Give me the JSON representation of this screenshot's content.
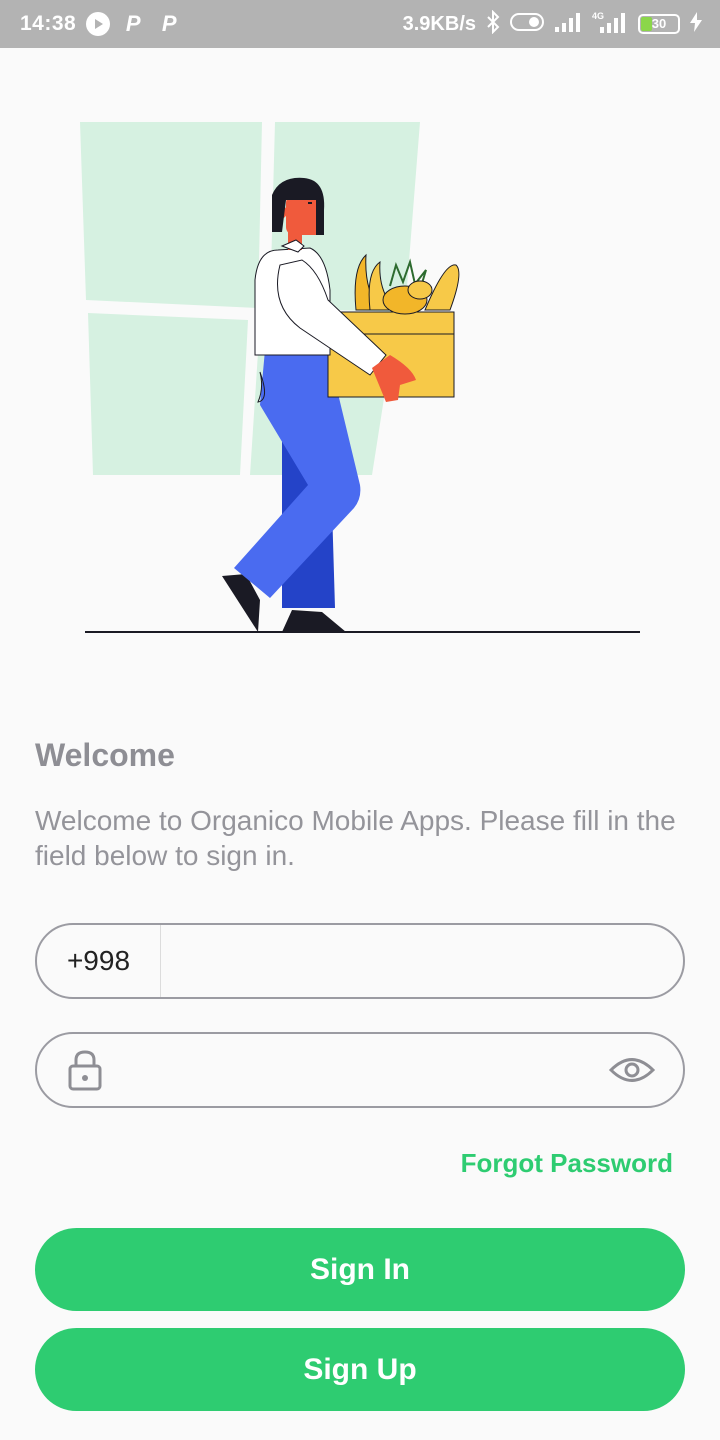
{
  "status_bar": {
    "time": "14:38",
    "app_icon_1": "P",
    "app_icon_2": "P",
    "speed": "3.9KB/s",
    "battery": "30",
    "icons": [
      "play-circle-icon",
      "bluetooth-icon",
      "toggle-icon",
      "signal-icon",
      "signal-4g-icon",
      "battery-icon",
      "charging-bolt-icon"
    ]
  },
  "illustration": {
    "name": "woman-carrying-groceries",
    "colors": {
      "window": "#d6f1e1",
      "pants": "#4a6bf0",
      "box": "#f7c948",
      "skin": "#f05a3c",
      "shirt": "#ffffff",
      "hair": "#1a1a24"
    }
  },
  "welcome": {
    "title": "Welcome",
    "message": "Welcome to Organico Mobile Apps. Please fill in the field below to sign in."
  },
  "form": {
    "country_code": "+998",
    "phone_value": "",
    "password_value": "",
    "forgot_label": "Forgot Password"
  },
  "buttons": {
    "sign_in": "Sign In",
    "sign_up": "Sign Up"
  },
  "colors": {
    "accent": "#2ecc71",
    "status_bar": "#b3b3b3",
    "text_muted": "#8e8e94",
    "border": "#9b9ba2"
  }
}
